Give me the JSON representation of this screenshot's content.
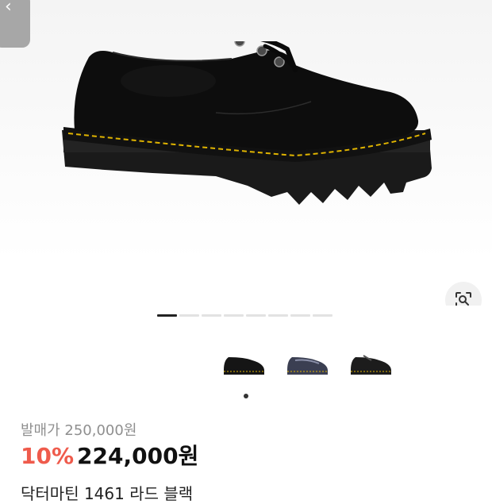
{
  "header": {
    "back_icon": "back-icon"
  },
  "gallery": {
    "image_count": 8,
    "active_index": 0,
    "lens_icon": "lens-search-icon"
  },
  "variants": {
    "items": [
      {
        "name": "black-smooth",
        "color": "#151515"
      },
      {
        "name": "navy-patent",
        "color": "#3b3f52"
      },
      {
        "name": "black-classic",
        "color": "#1c1c1c"
      }
    ],
    "selected_index": 0
  },
  "pricing": {
    "list_price": "발매가 250,000원",
    "discount": "10%",
    "sale_price": "224,000원"
  },
  "product": {
    "name": "닥터마틴 1461 라드 블랙"
  },
  "colors": {
    "discount": "#ef5b4c",
    "stitch": "#e0b400"
  }
}
